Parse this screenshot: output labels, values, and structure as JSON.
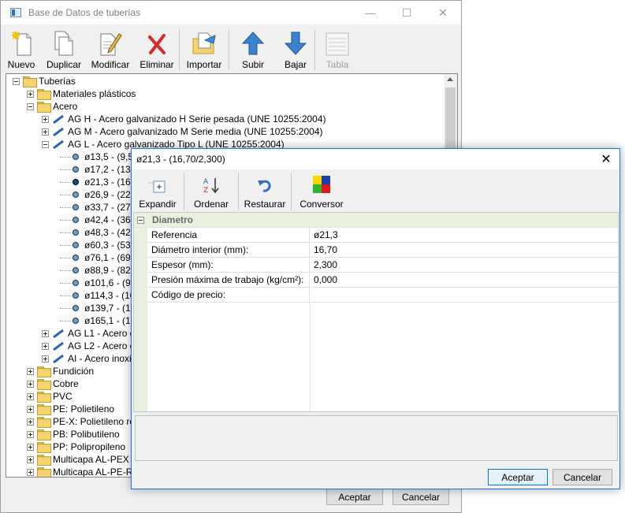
{
  "main": {
    "title": "Base de Datos de tuberías",
    "toolbar": {
      "nuevo": "Nuevo",
      "duplicar": "Duplicar",
      "modificar": "Modificar",
      "eliminar": "Eliminar",
      "importar": "Importar",
      "subir": "Subir",
      "bajar": "Bajar",
      "tabla": "Tabla"
    },
    "tree": {
      "root": "Tuberías",
      "plasticos": "Materiales plásticos",
      "acero": "Acero",
      "acero_children": [
        "AG H - Acero galvanizado H Serie pesada (UNE 10255:2004)",
        "AG M - Acero galvanizado M Serie media (UNE 10255:2004)",
        "AG L - Acero galvanizado Tipo L (UNE 10255:2004)"
      ],
      "diameters": [
        "ø13,5 - (9,50",
        "ø17,2 - (13,",
        "ø21,3 - (16,",
        "ø26,9 - (22,",
        "ø33,7 - (27,9",
        "ø42,4 - (36,",
        "ø48,3 - (42,",
        "ø60,3 - (53,9",
        "ø76,1 - (69,",
        "ø88,9 - (82,",
        "ø101,6 - (94",
        "ø114,3 - (10",
        "ø139,7 - (13",
        "ø165,1 - (15"
      ],
      "acero_more": [
        "AG L1 - Acero ga",
        "AG L2 - Acero ga",
        "AI - Acero inoxid"
      ],
      "others": [
        "Fundición",
        "Cobre",
        "PVC",
        "PE: Polietileno",
        "PE-X: Polietileno retic",
        "PB: Polibutileno",
        "PP: Polipropileno",
        "Multicapa AL-PEX",
        "Multicapa AL-PE-RT"
      ]
    },
    "aceptar": "Aceptar",
    "cancelar": "Cancelar"
  },
  "dialog": {
    "title": "ø21,3 - (16,70/2,300)",
    "toolbar": {
      "expandir": "Expandir",
      "ordenar": "Ordenar",
      "restaurar": "Restaurar",
      "conversor": "Conversor"
    },
    "section": "Diametro",
    "rows": [
      {
        "key": "Referencia",
        "value": "ø21,3"
      },
      {
        "key": "Diámetro interior (mm):",
        "value": "16,70"
      },
      {
        "key": "Espesor (mm):",
        "value": "2,300"
      },
      {
        "key": "Presión máxima de trabajo (kg/cm²):",
        "value": "0,000"
      },
      {
        "key": "Código de precio:",
        "value": ""
      }
    ],
    "aceptar": "Aceptar",
    "cancelar": "Cancelar"
  }
}
